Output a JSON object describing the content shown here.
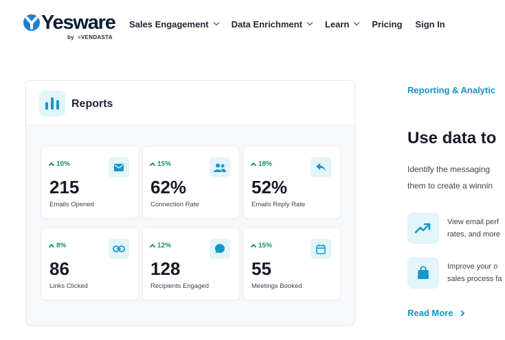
{
  "brand": {
    "name": "Yesware",
    "byline": "by",
    "partner": "VENDASTA",
    "accent": "#1593c4"
  },
  "nav": {
    "items": [
      {
        "label": "Sales Engagement",
        "dropdown": true
      },
      {
        "label": "Data Enrichment",
        "dropdown": true
      },
      {
        "label": "Learn",
        "dropdown": true
      },
      {
        "label": "Pricing",
        "dropdown": false
      },
      {
        "label": "Sign In",
        "dropdown": false
      }
    ]
  },
  "reports": {
    "title": "Reports",
    "icon": "bar-chart-icon",
    "tiles": [
      {
        "delta": "10%",
        "value": "215",
        "label": "Emails Opened",
        "icon": "envelope-icon"
      },
      {
        "delta": "15%",
        "value": "62%",
        "label": "Connection Rate",
        "icon": "people-icon"
      },
      {
        "delta": "18%",
        "value": "52%",
        "label": "Emails Reply Rate",
        "icon": "reply-icon"
      },
      {
        "delta": "8%",
        "value": "86",
        "label": "Links Clicked",
        "icon": "link-icon"
      },
      {
        "delta": "12%",
        "value": "128",
        "label": "Recipients Engaged",
        "icon": "chat-bubble-icon"
      },
      {
        "delta": "15%",
        "value": "55",
        "label": "Meetings Booked",
        "icon": "calendar-icon"
      }
    ],
    "delta_color": "#1b8e6d"
  },
  "content": {
    "eyebrow": "Reporting & Analytic",
    "headline": "Use data to",
    "paragraph_line1": "Identify the messaging",
    "paragraph_line2": "them to create a winnin",
    "features": [
      {
        "icon": "trend-up-icon",
        "line1": "View email perf",
        "line2": "rates, and more"
      },
      {
        "icon": "shopping-bag-icon",
        "line1": "Improve your o",
        "line2": "sales process fa"
      }
    ],
    "read_more": "Read More"
  }
}
